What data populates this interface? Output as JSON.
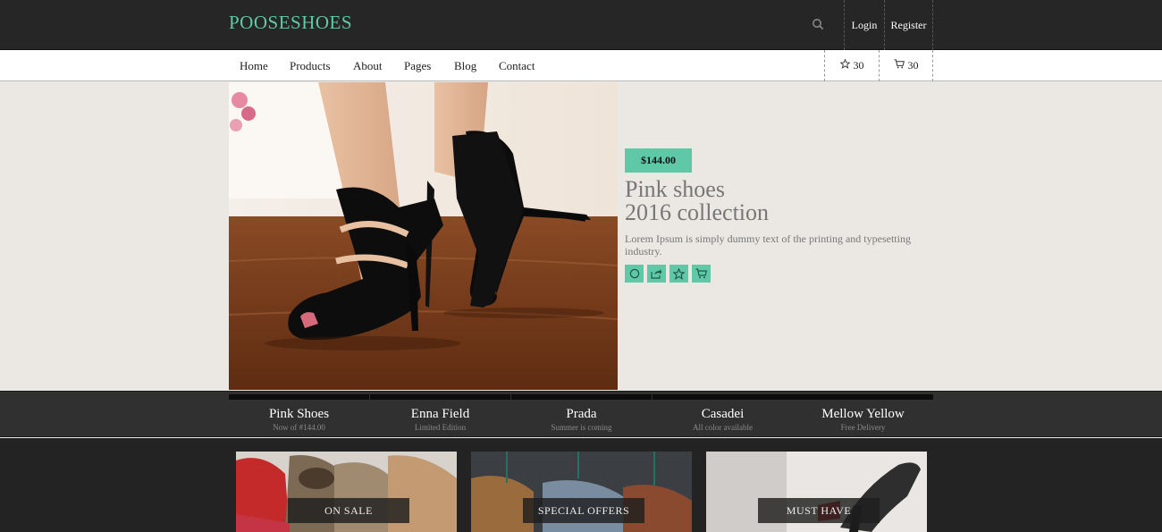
{
  "brand": {
    "name": "POOSESHOES",
    "accent": "#5fc9a7"
  },
  "topbar": {
    "search_icon": "search-icon",
    "login": "Login",
    "register": "Register"
  },
  "nav": {
    "items": [
      "Home",
      "Products",
      "About",
      "Pages",
      "Blog",
      "Contact"
    ],
    "wishlist_count": "30",
    "cart_count": "30"
  },
  "hero": {
    "price": "$144.00",
    "title_line1": "Pink shoes",
    "title_line2": "2016 collection",
    "description": "Lorem Ipsum is simply dummy text of the printing and typesetting industry.",
    "actions": [
      "circle-icon",
      "share-icon",
      "star-icon",
      "cart-icon"
    ]
  },
  "tabs": [
    {
      "title": "Pink Shoes",
      "subtitle": "Now of #144.00"
    },
    {
      "title": "Enna Field",
      "subtitle": "Limited Edition"
    },
    {
      "title": "Prada",
      "subtitle": "Summer is coming"
    },
    {
      "title": "Casadei",
      "subtitle": "All color available"
    },
    {
      "title": "Mellow Yellow",
      "subtitle": "Free Delivery"
    }
  ],
  "promos": [
    {
      "label": "ON SALE"
    },
    {
      "label": "SPECIAL OFFERS"
    },
    {
      "label": "MUST HAVE"
    }
  ]
}
